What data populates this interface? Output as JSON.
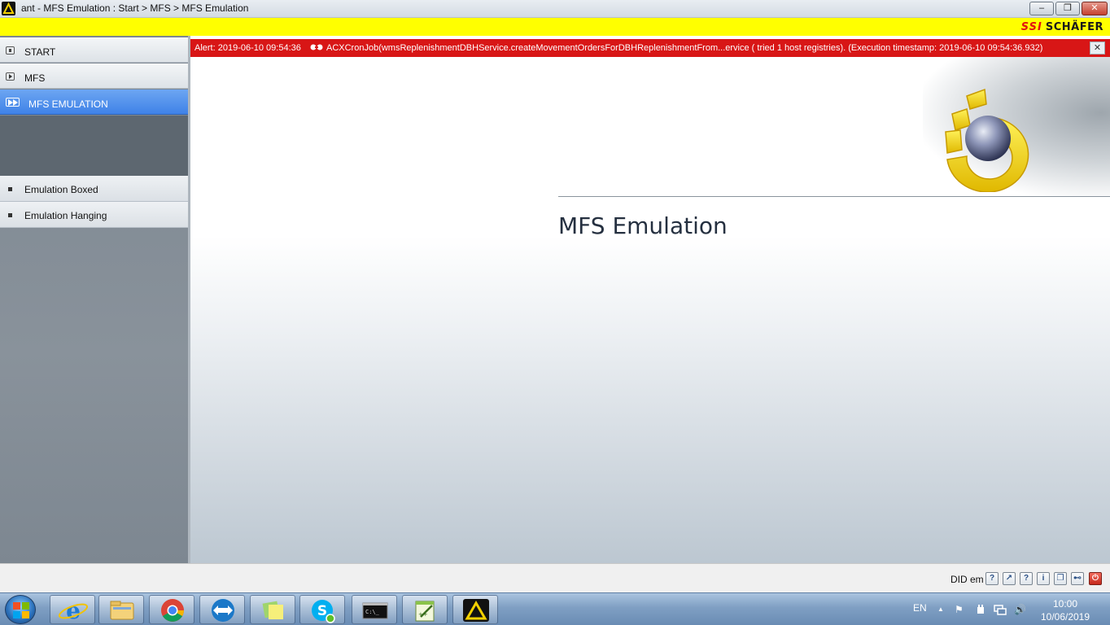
{
  "window": {
    "title": "ant - MFS Emulation : Start > MFS > MFS Emulation",
    "min_glyph": "‒",
    "max_glyph": "❐",
    "close_glyph": "✕"
  },
  "brand": {
    "ssi": "SSI",
    "name": "SCHÄFER"
  },
  "sidebar": {
    "items": [
      {
        "label": "START"
      },
      {
        "label": "MFS"
      },
      {
        "label": "MFS EMULATION"
      }
    ],
    "subitems": [
      {
        "label": "Emulation Boxed"
      },
      {
        "label": "Emulation Hanging"
      }
    ]
  },
  "alert": {
    "label": "Alert:  2019-06-10 09:54:36",
    "message": "ACXCronJob(wmsReplenishmentDBHService.createMovementOrdersForDBHReplenishmentFrom...ervice ( tried 1 host registries). (Execution timestamp: 2019-06-10 09:54:36.932)",
    "close_glyph": "✕",
    "color": "#d81616"
  },
  "main": {
    "title": "MFS Emulation"
  },
  "statusbar": {
    "user": "DID em",
    "buttons": [
      "?",
      "↗",
      "?",
      "i",
      "❐",
      "⊷",
      "⏻"
    ]
  },
  "taskbar": {
    "apps": [
      "internet-explorer",
      "file-explorer",
      "chrome",
      "teamviewer",
      "sticky-notes",
      "skype",
      "command-prompt",
      "notepad-plus-plus",
      "ant-app"
    ],
    "lang": "EN",
    "tray_arrow": "▲",
    "tray_flag": "⚑",
    "tray_speaker": "🔊",
    "time": "10:00",
    "date": "10/06/2019"
  }
}
